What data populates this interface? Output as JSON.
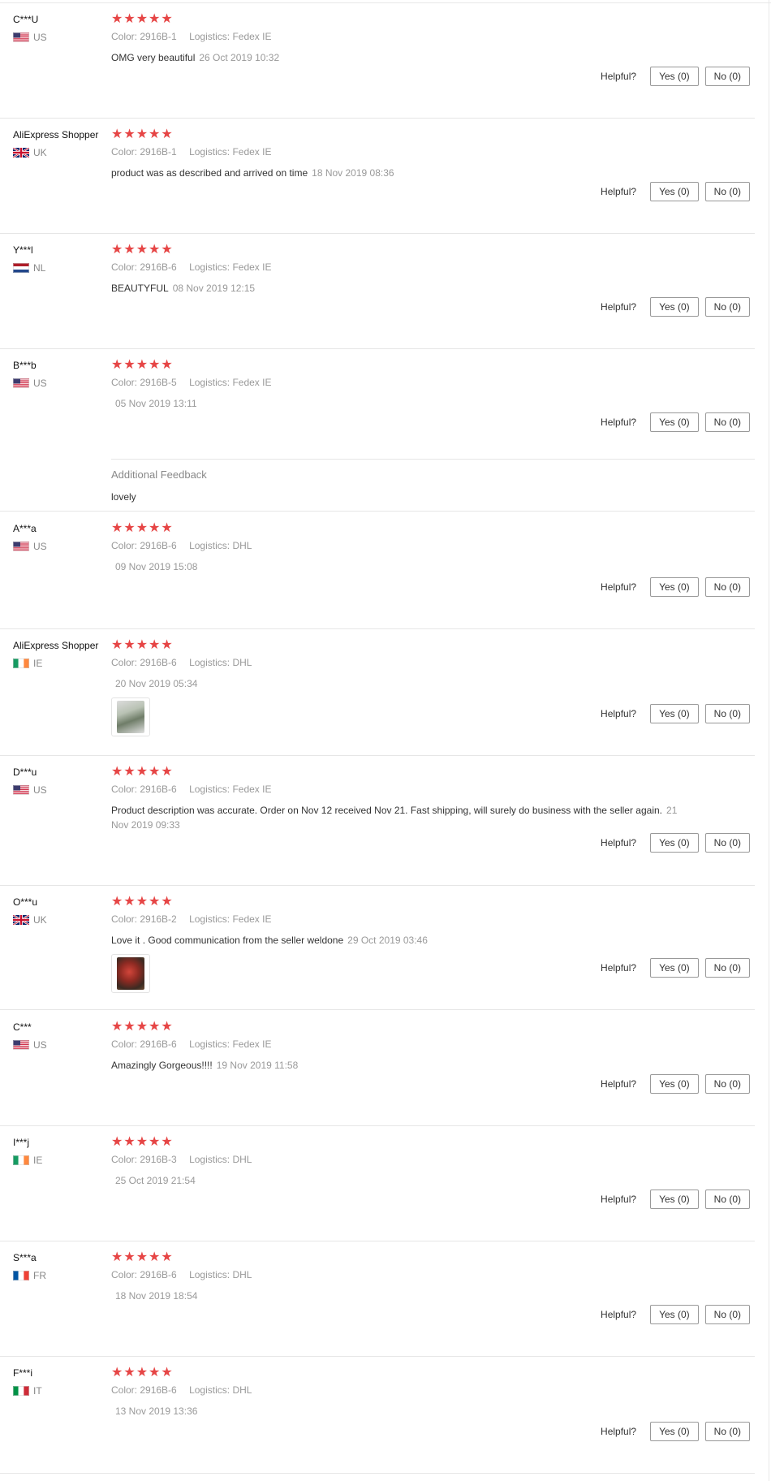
{
  "helpful_label": "Helpful?",
  "colors": {
    "star": "#e64545",
    "muted": "#999999",
    "text": "#333333"
  },
  "reviews": [
    {
      "user": "C***U",
      "country": "US",
      "flag": "us-flag",
      "stars": "★★★★★",
      "color_label": "Color:",
      "color": "2916B-1",
      "logistics_label": "Logistics:",
      "logistics": "Fedex IE",
      "text": "OMG very beautiful",
      "date": "26 Oct 2019 10:32",
      "yes": "Yes (0)",
      "no": "No (0)"
    },
    {
      "user": "AliExpress Shopper",
      "country": "UK",
      "flag": "uk-flag",
      "stars": "★★★★★",
      "color_label": "Color:",
      "color": "2916B-1",
      "logistics_label": "Logistics:",
      "logistics": "Fedex IE",
      "text": "product was as described and arrived on time",
      "date": "18 Nov 2019 08:36",
      "yes": "Yes (0)",
      "no": "No (0)"
    },
    {
      "user": "Y***l",
      "country": "NL",
      "flag": "nl-flag",
      "stars": "★★★★★",
      "color_label": "Color:",
      "color": "2916B-6",
      "logistics_label": "Logistics:",
      "logistics": "Fedex IE",
      "text": "BEAUTYFUL",
      "date": "08 Nov 2019 12:15",
      "yes": "Yes (0)",
      "no": "No (0)"
    },
    {
      "user": "B***b",
      "country": "US",
      "flag": "us-flag",
      "stars": "★★★★★",
      "color_label": "Color:",
      "color": "2916B-5",
      "logistics_label": "Logistics:",
      "logistics": "Fedex IE",
      "text": "",
      "date": "05 Nov 2019 13:11",
      "yes": "Yes (0)",
      "no": "No (0)",
      "additional_title": "Additional Feedback",
      "additional_text": "lovely"
    },
    {
      "user": "A***a",
      "country": "US",
      "flag": "us-flag",
      "stars": "★★★★★",
      "color_label": "Color:",
      "color": "2916B-6",
      "logistics_label": "Logistics:",
      "logistics": "DHL",
      "text": "",
      "date": "09 Nov 2019 15:08",
      "yes": "Yes (0)",
      "no": "No (0)"
    },
    {
      "user": "AliExpress Shopper",
      "country": "IE",
      "flag": "ie-flag",
      "stars": "★★★★★",
      "color_label": "Color:",
      "color": "2916B-6",
      "logistics_label": "Logistics:",
      "logistics": "DHL",
      "text": "",
      "date": "20 Nov 2019 05:34",
      "yes": "Yes (0)",
      "no": "No (0)",
      "photo": "plant-photo"
    },
    {
      "user": "D***u",
      "country": "US",
      "flag": "us-flag",
      "stars": "★★★★★",
      "color_label": "Color:",
      "color": "2916B-6",
      "logistics_label": "Logistics:",
      "logistics": "Fedex IE",
      "text": "Product description was accurate. Order on Nov 12 received Nov 21. Fast shipping, will surely do business with the seller again.",
      "date": "21 Nov 2019 09:33",
      "yes": "Yes (0)",
      "no": "No (0)"
    },
    {
      "user": "O***u",
      "country": "UK",
      "flag": "uk-flag",
      "stars": "★★★★★",
      "color_label": "Color:",
      "color": "2916B-2",
      "logistics_label": "Logistics:",
      "logistics": "Fedex IE",
      "text": "Love it . Good communication from the seller weldone",
      "date": "29 Oct 2019 03:46",
      "yes": "Yes (0)",
      "no": "No (0)",
      "photo": "flower-photo"
    },
    {
      "user": "C***",
      "country": "US",
      "flag": "us-flag",
      "stars": "★★★★★",
      "color_label": "Color:",
      "color": "2916B-6",
      "logistics_label": "Logistics:",
      "logistics": "Fedex IE",
      "text": "Amazingly Gorgeous!!!!",
      "date": "19 Nov 2019 11:58",
      "yes": "Yes (0)",
      "no": "No (0)"
    },
    {
      "user": "I***j",
      "country": "IE",
      "flag": "ie-flag",
      "stars": "★★★★★",
      "color_label": "Color:",
      "color": "2916B-3",
      "logistics_label": "Logistics:",
      "logistics": "DHL",
      "text": "",
      "date": "25 Oct 2019 21:54",
      "yes": "Yes (0)",
      "no": "No (0)"
    },
    {
      "user": "S***a",
      "country": "FR",
      "flag": "fr-flag",
      "stars": "★★★★★",
      "color_label": "Color:",
      "color": "2916B-6",
      "logistics_label": "Logistics:",
      "logistics": "DHL",
      "text": "",
      "date": "18 Nov 2019 18:54",
      "yes": "Yes (0)",
      "no": "No (0)"
    },
    {
      "user": "F***i",
      "country": "IT",
      "flag": "it-flag",
      "stars": "★★★★★",
      "color_label": "Color:",
      "color": "2916B-6",
      "logistics_label": "Logistics:",
      "logistics": "DHL",
      "text": "",
      "date": "13 Nov 2019 13:36",
      "yes": "Yes (0)",
      "no": "No (0)"
    }
  ]
}
